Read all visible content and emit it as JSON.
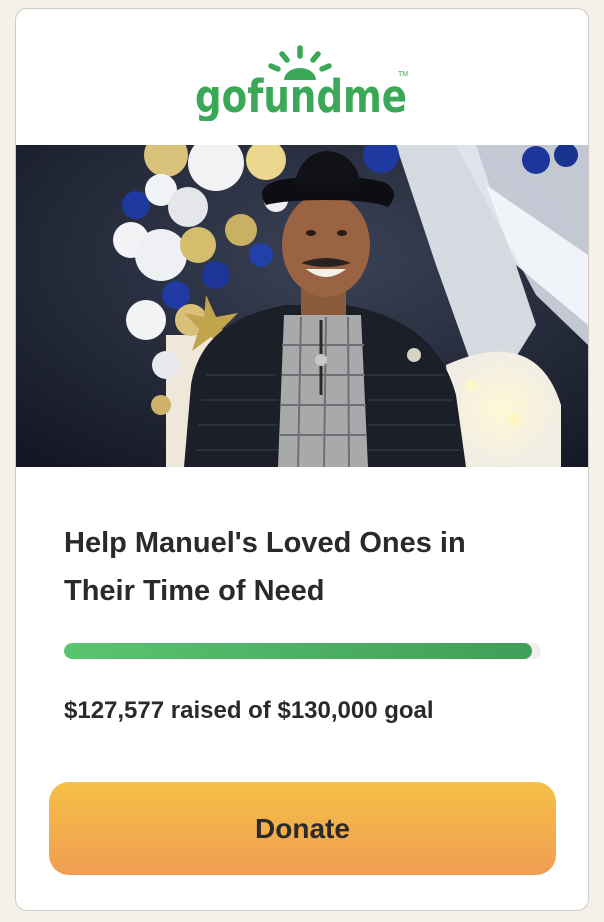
{
  "brand": {
    "name": "gofundme",
    "trademark": "TM",
    "color": "#3aa857",
    "icon": "sunrise-logo-icon"
  },
  "campaign": {
    "title": "Help Manuel's Loved Ones in Their Time of Need",
    "raised_text": "$127,577 raised of $130,000 goal",
    "raised_amount": 127577,
    "goal_amount": 130000,
    "progress_fraction": 0.981
  },
  "actions": {
    "donate_label": "Donate",
    "donate_color_top": "#f6c046",
    "donate_color_bottom": "#ef9d52"
  },
  "colors": {
    "progress_start": "#5bc470",
    "progress_end": "#3f9e58",
    "text": "#2a2a2a"
  }
}
